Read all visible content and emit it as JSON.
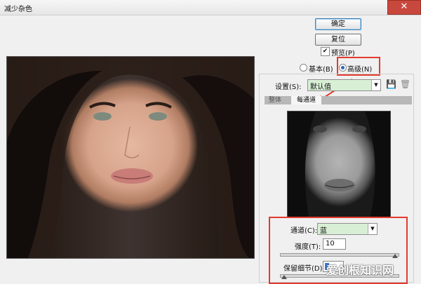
{
  "window": {
    "title": "减少杂色",
    "close_glyph": "✕"
  },
  "buttons": {
    "ok": "确定",
    "reset": "复位"
  },
  "preview_checkbox": {
    "label": "预览(P)",
    "checked": true,
    "check_glyph": "✔"
  },
  "mode": {
    "options": [
      {
        "label": "基本(B)",
        "selected": false
      },
      {
        "label": "高级(N)",
        "selected": true
      }
    ]
  },
  "settings": {
    "label": "设置(S):",
    "value": "默认值",
    "save_icon": "💾",
    "delete_icon": "🗑"
  },
  "tabs": [
    {
      "label": "整体",
      "active": false
    },
    {
      "label": "每通道",
      "active": true
    }
  ],
  "channel": {
    "label": "通道(C):",
    "value": "蓝"
  },
  "strength": {
    "label": "强度(T):",
    "value": "10",
    "level_fraction": 1.0
  },
  "preserve_detail": {
    "label": "保留细节(D):",
    "value": "",
    "level_fraction": 0.0
  },
  "dropdown_glyph": "▼",
  "watermark": {
    "text": "爱创根知识网"
  },
  "colors": {
    "highlight": "#e23b2e",
    "combo_bg": "#d8efd6",
    "radio_dot": "#2a67b0"
  }
}
